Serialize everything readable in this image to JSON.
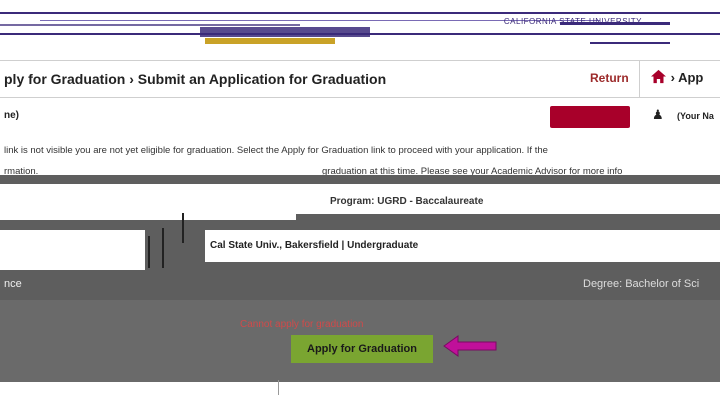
{
  "header": {
    "banner_tag": "CALIFORNIA STATE UNIVERSITY",
    "colors": {
      "brand_purple": "#3b2a7a",
      "brand_gold": "#c9a227",
      "accent_red": "#a8002a",
      "action_green": "#7aa531",
      "arrow_magenta": "#c0109a"
    }
  },
  "titlebar": {
    "title": "ply for Graduation › Submit an Application for Graduation",
    "return_label": "Return",
    "home_label": "› App"
  },
  "row2": {
    "name_field": "ne)",
    "user_name": "(Your Na"
  },
  "instructions": {
    "line1": "link is not visible you are not yet eligible for graduation. Select the Apply for Graduation link to proceed with your application. If the",
    "line2": "rmation.",
    "line3": "graduation at this time. Please see your Academic Advisor for more info"
  },
  "content": {
    "program": "Program: UGRD - Baccalaureate",
    "campus": "Cal State Univ., Bakersfield | Undergraduate",
    "left_label": "nce",
    "degree": "Degree: Bachelor of Sci",
    "disabled_note": "Cannot apply for graduation",
    "apply_button": "Apply for Graduation"
  }
}
